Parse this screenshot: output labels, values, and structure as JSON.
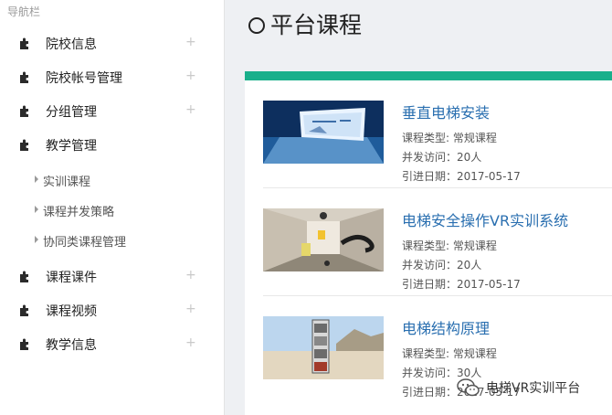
{
  "sidebar": {
    "title": "导航栏",
    "plus": "+",
    "items": [
      {
        "label": "院校信息",
        "icon": "puzzle-icon"
      },
      {
        "label": "院校帐号管理",
        "icon": "puzzle-icon"
      },
      {
        "label": "分组管理",
        "icon": "puzzle-icon"
      },
      {
        "label": "教学管理",
        "icon": "puzzle-icon"
      },
      {
        "label": "课程课件",
        "icon": "puzzle-icon"
      },
      {
        "label": "课程视频",
        "icon": "puzzle-icon"
      },
      {
        "label": "教学信息",
        "icon": "puzzle-icon"
      }
    ],
    "sub_items": [
      {
        "label": "实训课程"
      },
      {
        "label": "课程并发策略"
      },
      {
        "label": "协同类课程管理"
      }
    ]
  },
  "main": {
    "title": "平台课程",
    "accent_color": "#1aaf8b",
    "courses": [
      {
        "name": "垂直电梯安装",
        "type": "课程类型: 常规课程",
        "visits": "并发访问：20人",
        "date": "引进日期：2017-05-17"
      },
      {
        "name": "电梯安全操作VR实训系统",
        "type": "课程类型: 常规课程",
        "visits": "并发访问：20人",
        "date": "引进日期：2017-05-17"
      },
      {
        "name": "电梯结构原理",
        "type": "课程类型: 常规课程",
        "visits": "并发访问：30人",
        "date": "引进日期：2017-05-17"
      }
    ]
  },
  "watermark": {
    "text": "电梯VR实训平台"
  }
}
